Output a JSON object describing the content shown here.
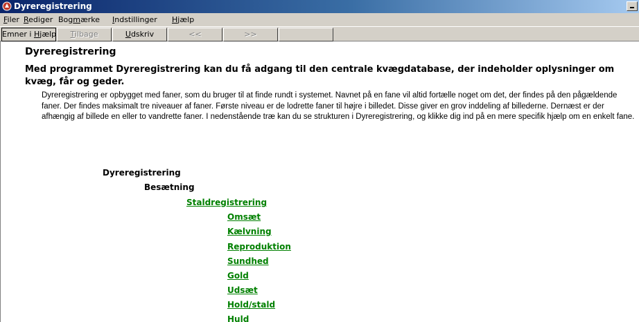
{
  "window": {
    "title": "Dyreregistrering"
  },
  "menu": [
    {
      "before": "",
      "mnemonic": "F",
      "after": "iler"
    },
    {
      "before": "",
      "mnemonic": "R",
      "after": "ediger"
    },
    {
      "before": "Bog",
      "mnemonic": "m",
      "after": "ærke"
    },
    {
      "before": "",
      "mnemonic": "I",
      "after": "ndstillinger"
    },
    {
      "before": "",
      "mnemonic": "H",
      "after": "jælp"
    }
  ],
  "toolbar": {
    "topics": {
      "before": "Emner i ",
      "mnemonic": "H",
      "after": "jælp"
    },
    "back": {
      "before": "",
      "mnemonic": "T",
      "after": "ilbage"
    },
    "print": {
      "before": "",
      "mnemonic": "U",
      "after": "dskriv"
    },
    "prev": "<<",
    "next": ">>"
  },
  "page": {
    "title": "Dyreregistrering",
    "intro": "Med programmet Dyreregistrering kan du få adgang til den centrale kvægdatabase, der indeholder oplysninger om kvæg, får og geder.",
    "body": "Dyreregistrering er opbygget med faner, som du bruger til at finde rundt i systemet. Navnet på en fane vil altid fortælle noget om det, der findes på den pågældende faner. Der findes maksimalt tre niveauer af faner. Første niveau er de lodrette faner til højre i billedet. Disse giver en grov inddeling af billederne. Dernæst er der afhængig af billede en eller to vandrette faner. I nedenstående træ kan du se strukturen i Dyreregistrering, og klikke dig ind på en mere specifik hjælp om en enkelt fane."
  },
  "tree": {
    "root": "Dyreregistrering",
    "level1": "Besætning",
    "level2": "Staldregistrering",
    "level3": [
      "Omsæt",
      "Kælvning",
      "Reproduktion",
      "Sundhed",
      "Gold",
      "Udsæt",
      "Hold/stald",
      "Huld"
    ]
  }
}
